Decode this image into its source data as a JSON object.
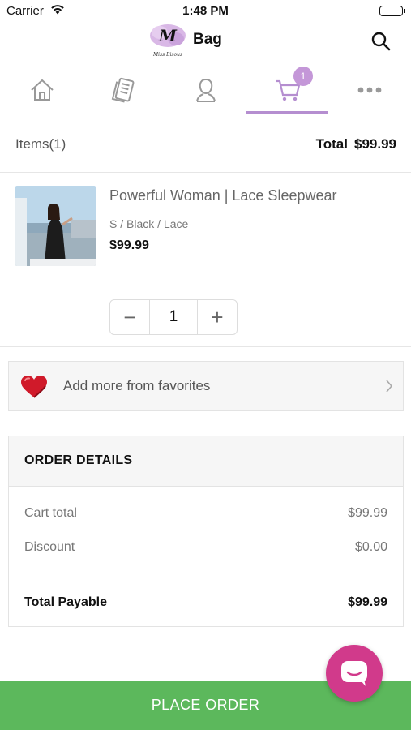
{
  "status_bar": {
    "carrier": "Carrier",
    "time": "1:48 PM"
  },
  "header": {
    "title": "Bag",
    "logo_letter": "M",
    "logo_caption": "Miss Bisous"
  },
  "tabs": [
    {
      "name": "home",
      "icon": "home-icon"
    },
    {
      "name": "catalog",
      "icon": "catalog-icon"
    },
    {
      "name": "profile",
      "icon": "user-icon"
    },
    {
      "name": "cart",
      "icon": "cart-icon",
      "badge": "1",
      "active": true
    },
    {
      "name": "more",
      "icon": "more-icon"
    }
  ],
  "summary": {
    "items_label": "Items(1)",
    "total_label": "Total",
    "total_value": "$99.99"
  },
  "cart_item": {
    "name": "Powerful Woman | Lace Sleepwear",
    "variant": "S / Black / Lace",
    "price": "$99.99",
    "quantity": "1",
    "minus": "−",
    "plus": "+"
  },
  "favorites": {
    "label": "Add more from favorites",
    "icon": "heart-icon"
  },
  "order_details": {
    "title": "ORDER DETAILS",
    "cart_total_label": "Cart total",
    "cart_total_value": "$99.99",
    "discount_label": "Discount",
    "discount_value": "$0.00",
    "payable_label": "Total Payable",
    "payable_value": "$99.99"
  },
  "place_order": "PLACE ORDER",
  "colors": {
    "accent": "#b58ed0",
    "badge": "#c497d8",
    "chat": "#d13a8b",
    "place_order": "#5cb85c",
    "heart": "#d01a2a"
  }
}
